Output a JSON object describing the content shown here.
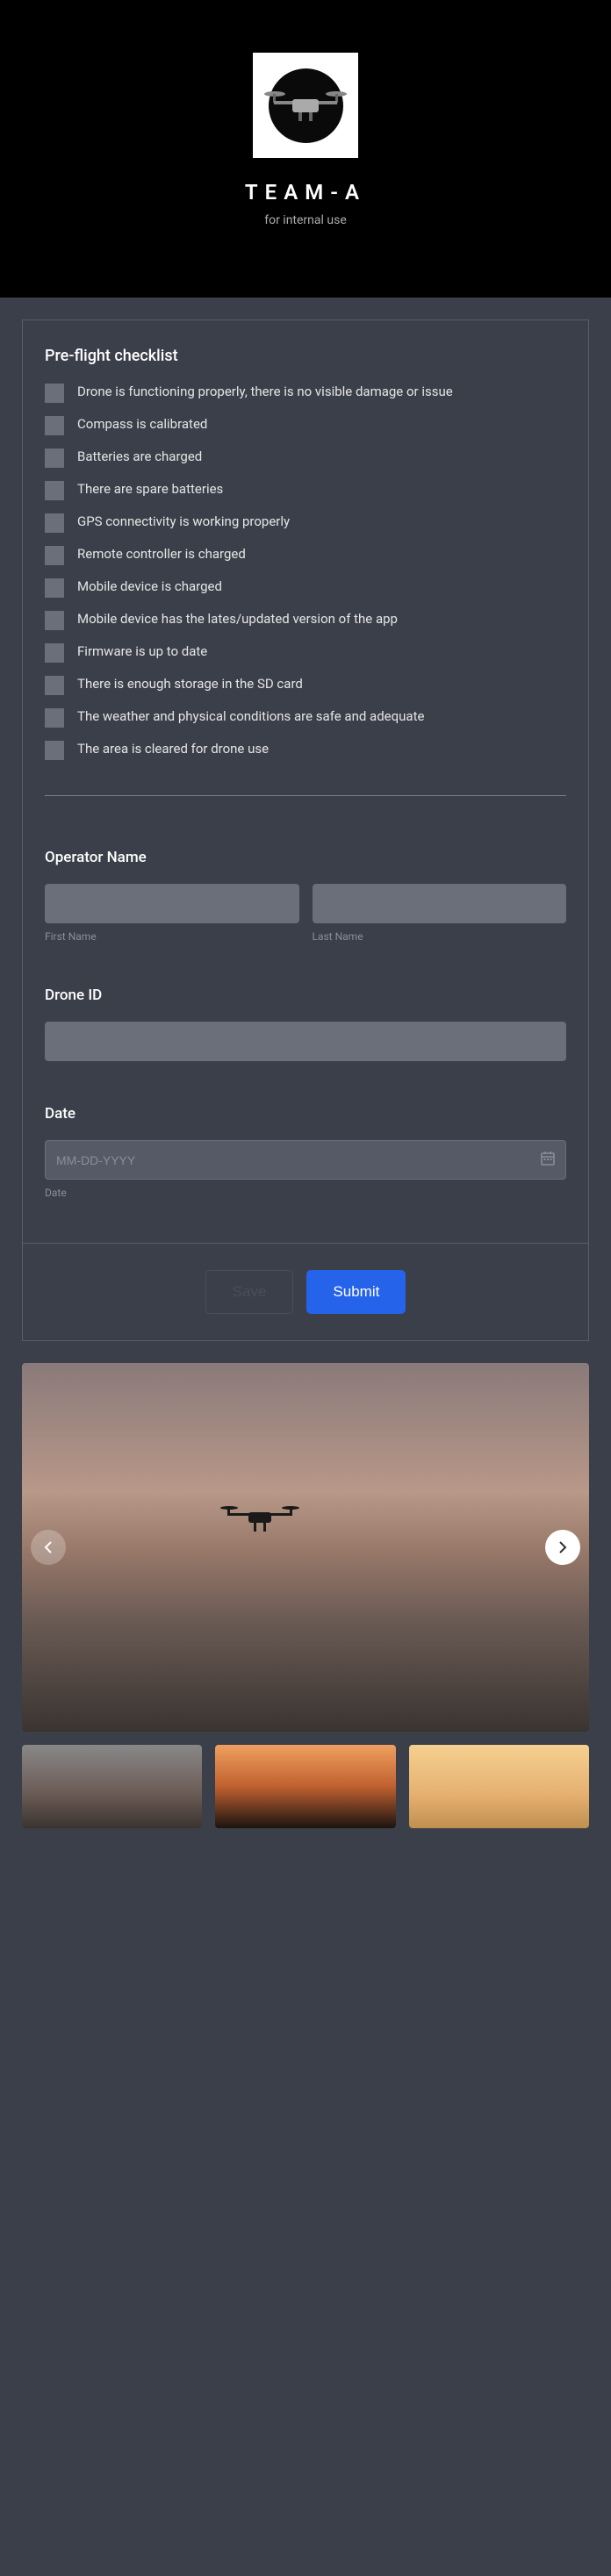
{
  "header": {
    "team": "TEAM-A",
    "subtitle": "for internal use"
  },
  "checklist": {
    "title": "Pre-flight checklist",
    "items": [
      "Drone is functioning properly, there is no visible damage or issue",
      "Compass is calibrated",
      "Batteries are charged",
      "There are spare batteries",
      "GPS connectivity is working properly",
      "Remote controller is charged",
      "Mobile device is charged",
      "Mobile device has the lates/updated version of the app",
      "Firmware is up to date",
      "There is enough storage in the SD card",
      "The weather and physical conditions are safe and adequate",
      "The area is cleared for drone use"
    ]
  },
  "operator": {
    "label": "Operator Name",
    "firstSub": "First Name",
    "lastSub": "Last Name"
  },
  "droneId": {
    "label": "Drone ID"
  },
  "date": {
    "label": "Date",
    "placeholder": "MM-DD-YYYY",
    "sub": "Date"
  },
  "actions": {
    "save": "Save",
    "submit": "Submit"
  }
}
